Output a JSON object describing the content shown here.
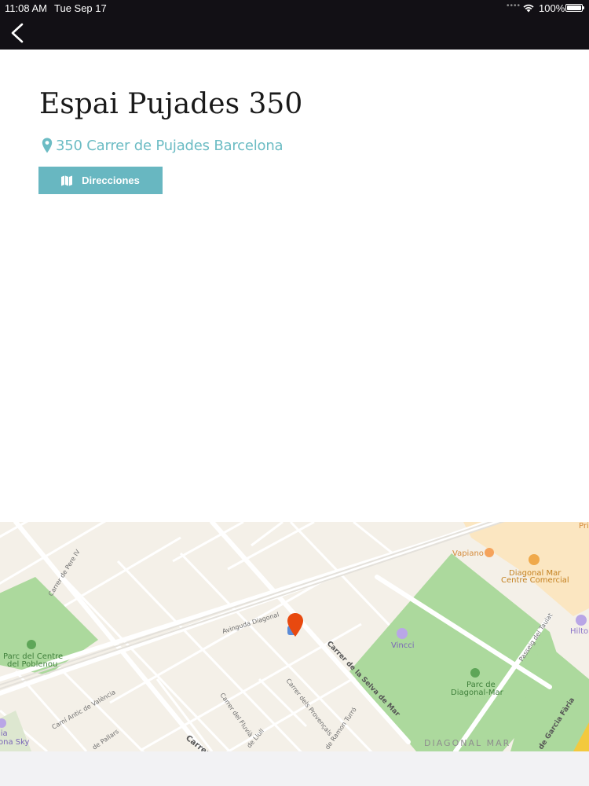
{
  "status_bar": {
    "time": "11:08 AM",
    "date": "Tue Sep 17",
    "battery": "100%",
    "signal_icon": "signal-dots",
    "wifi_icon": "wifi-icon",
    "battery_icon": "battery-icon"
  },
  "nav": {
    "back_icon": "chevron-left-icon"
  },
  "venue": {
    "name": "Espai Pujades 350",
    "address": "350 Carrer de Pujades Barcelona",
    "address_icon": "location-pin-icon"
  },
  "directions_button": {
    "label": "Direcciones",
    "icon": "map-icon"
  },
  "map": {
    "labels": {
      "prim": "Pri",
      "vapiano": "Vapiano",
      "diagonal_mar_1": "Diagonal Mar",
      "diagonal_mar_2": "Centre Comercial",
      "hilton": "Hilto",
      "avinguda_diagonal": "Avinguda Diagonal",
      "vincci": "Vincci",
      "carrer_selva": "Carrer de la Selva de Mar",
      "passeig_taulat": "Passeig del Taulat",
      "parc_centre_1": "Parc del Centre",
      "parc_centre_2": "del Poblenou",
      "parc_diagonal_1": "Parc de",
      "parc_diagonal_2": "Diagonal-Mar",
      "carrer_pere_iv": "Carrer de Pere IV",
      "cami_valencia": "Camí Antic de València",
      "carrer_fluvia": "Carrer del Fluvià",
      "carrer_provencals": "Carrer dels Provençals",
      "ramon_turro": "de Ramon Turró",
      "carrer_pallars": "de Pallars",
      "carrer_lull": "de Llull",
      "carrer_bold": "Carrer",
      "carrer_garcia": "de Garcia Fària",
      "diagonal_mar_area": "DIAGONAL MAR",
      "ona_sky_1": "lia",
      "ona_sky_2": "ona Sky"
    },
    "marker_color": "#e8490f",
    "park_color": "#a9d99b",
    "mall_color": "#fbe5c0",
    "land_color": "#f5f1e9"
  },
  "colors": {
    "accent": "#68b7c1",
    "address_text": "#6cbcc4",
    "nav_background": "#121015"
  }
}
